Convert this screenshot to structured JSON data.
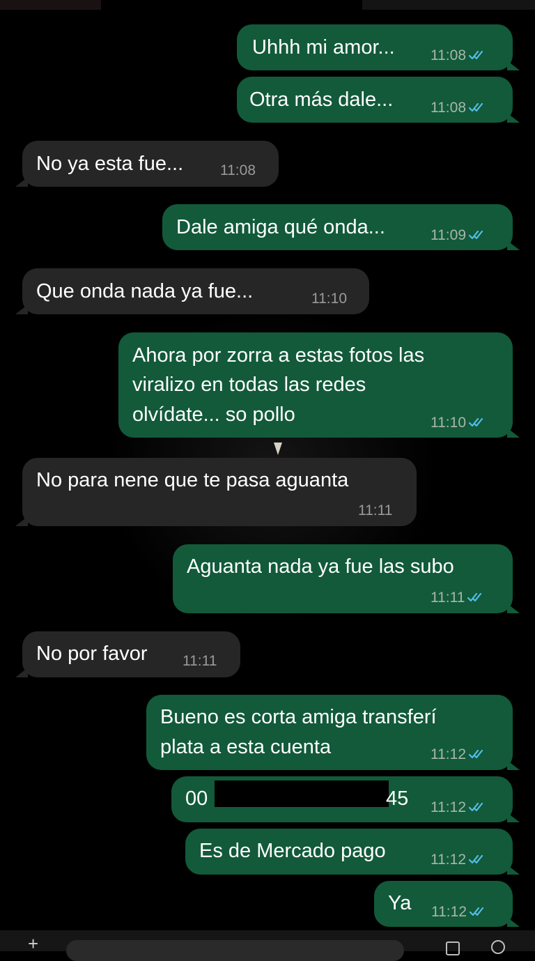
{
  "messages": [
    {
      "dir": "out",
      "text": "Uhhh mi amor...",
      "time": "11:08",
      "ticks": true
    },
    {
      "dir": "out",
      "text": "Otra más dale...",
      "time": "11:08",
      "ticks": true
    },
    {
      "dir": "in",
      "text": "No ya esta fue...",
      "time": "11:08"
    },
    {
      "dir": "out",
      "text": "Dale amiga qué onda...",
      "time": "11:09",
      "ticks": true
    },
    {
      "dir": "in",
      "text": "Que onda nada ya fue...",
      "time": "11:10"
    },
    {
      "dir": "out",
      "lines": [
        "Ahora por zorra a estas fotos las",
        "viralizo en todas las redes",
        "olvídate... so pollo"
      ],
      "time": "11:10",
      "ticks": true
    },
    {
      "dir": "in",
      "text": "No para nene que te pasa aguanta",
      "time": "11:11"
    },
    {
      "dir": "out",
      "text": "Aguanta nada ya fue las subo",
      "time": "11:11",
      "ticks": true
    },
    {
      "dir": "in",
      "text": "No por favor",
      "time": "11:11"
    },
    {
      "dir": "out",
      "lines": [
        "Bueno es corta amiga transferí",
        "plata a esta cuenta"
      ],
      "time": "11:12",
      "ticks": true
    },
    {
      "dir": "out",
      "text_start": "00",
      "text_end": "45",
      "time": "11:12",
      "ticks": true,
      "redacted": true
    },
    {
      "dir": "out",
      "text": "Es de Mercado pago",
      "time": "11:12",
      "ticks": true
    },
    {
      "dir": "out",
      "text": "Ya",
      "time": "11:12",
      "ticks": true
    }
  ],
  "colors": {
    "outgoing_bubble": "#125a3a",
    "incoming_bubble": "#262626",
    "read_ticks": "#53bdeb",
    "background": "#000000"
  },
  "icons": {
    "read_receipt": "double-check-icon",
    "attach": "plus-icon"
  }
}
